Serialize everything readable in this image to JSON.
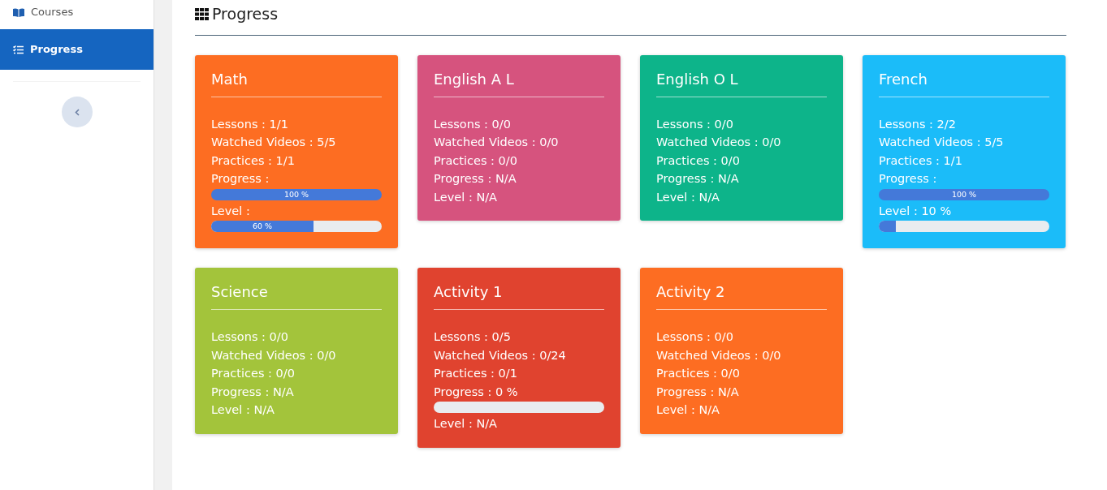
{
  "sidebar": {
    "items": [
      {
        "label": "Courses",
        "selected": false
      },
      {
        "label": "Progress",
        "selected": true
      }
    ]
  },
  "page": {
    "title": "Progress"
  },
  "cards": [
    {
      "title": "Math",
      "color": "#fd6d22",
      "lines": [
        {
          "kind": "text",
          "text": "Lessons : 1/1"
        },
        {
          "kind": "text",
          "text": "Watched Videos : 5/5"
        },
        {
          "kind": "text",
          "text": "Practices : 1/1"
        },
        {
          "kind": "text",
          "text": "Progress :"
        },
        {
          "kind": "bar",
          "level": 1,
          "label": "100 %"
        },
        {
          "kind": "text",
          "text": "Level :"
        },
        {
          "kind": "bar",
          "level": 0.6,
          "label": "60 %"
        }
      ]
    },
    {
      "title": "English A L",
      "color": "#d6537e",
      "lines": [
        {
          "kind": "text",
          "text": "Lessons : 0/0"
        },
        {
          "kind": "text",
          "text": "Watched Videos : 0/0"
        },
        {
          "kind": "text",
          "text": "Practices : 0/0"
        },
        {
          "kind": "text",
          "text": "Progress : N/A"
        },
        {
          "kind": "text",
          "text": "Level : N/A"
        }
      ]
    },
    {
      "title": "English O L",
      "color": "#0db48a",
      "lines": [
        {
          "kind": "text",
          "text": "Lessons : 0/0"
        },
        {
          "kind": "text",
          "text": "Watched Videos : 0/0"
        },
        {
          "kind": "text",
          "text": "Practices : 0/0"
        },
        {
          "kind": "text",
          "text": "Progress : N/A"
        },
        {
          "kind": "text",
          "text": "Level : N/A"
        }
      ]
    },
    {
      "title": "French",
      "color": "#1bbcf9",
      "lines": [
        {
          "kind": "text",
          "text": "Lessons : 2/2"
        },
        {
          "kind": "text",
          "text": "Watched Videos : 5/5"
        },
        {
          "kind": "text",
          "text": "Practices : 1/1"
        },
        {
          "kind": "text",
          "text": "Progress :"
        },
        {
          "kind": "bar",
          "level": 1,
          "label": "100 %"
        },
        {
          "kind": "text",
          "text": "Level : 10 %"
        },
        {
          "kind": "bar",
          "level": 0.1
        }
      ]
    },
    {
      "title": "Science",
      "color": "#a3c43b",
      "lines": [
        {
          "kind": "text",
          "text": "Lessons : 0/0"
        },
        {
          "kind": "text",
          "text": "Watched Videos : 0/0"
        },
        {
          "kind": "text",
          "text": "Practices : 0/0"
        },
        {
          "kind": "text",
          "text": "Progress : N/A"
        },
        {
          "kind": "text",
          "text": "Level : N/A"
        }
      ]
    },
    {
      "title": "Activity 1",
      "color": "#e0432f",
      "lines": [
        {
          "kind": "text",
          "text": "Lessons : 0/5"
        },
        {
          "kind": "text",
          "text": "Watched Videos : 0/24"
        },
        {
          "kind": "text",
          "text": "Practices : 0/1"
        },
        {
          "kind": "text",
          "text": "Progress : 0 %"
        },
        {
          "kind": "bar",
          "level": 0
        },
        {
          "kind": "text",
          "text": "Level : N/A"
        }
      ]
    },
    {
      "title": "Activity 2",
      "color": "#fd6d22",
      "lines": [
        {
          "kind": "text",
          "text": "Lessons : 0/0"
        },
        {
          "kind": "text",
          "text": "Watched Videos : 0/0"
        },
        {
          "kind": "text",
          "text": "Practices : 0/0"
        },
        {
          "kind": "text",
          "text": "Progress : N/A"
        },
        {
          "kind": "text",
          "text": "Level : N/A"
        }
      ]
    }
  ]
}
